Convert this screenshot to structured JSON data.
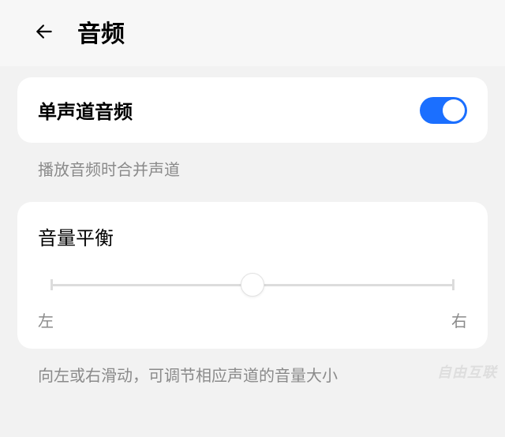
{
  "header": {
    "title": "音频"
  },
  "mono": {
    "title": "单声道音频",
    "enabled": true,
    "description": "播放音频时合并声道"
  },
  "balance": {
    "title": "音量平衡",
    "left_label": "左",
    "right_label": "右",
    "value": 50,
    "description": "向左或右滑动，可调节相应声道的音量大小"
  },
  "watermark": "自由互联"
}
